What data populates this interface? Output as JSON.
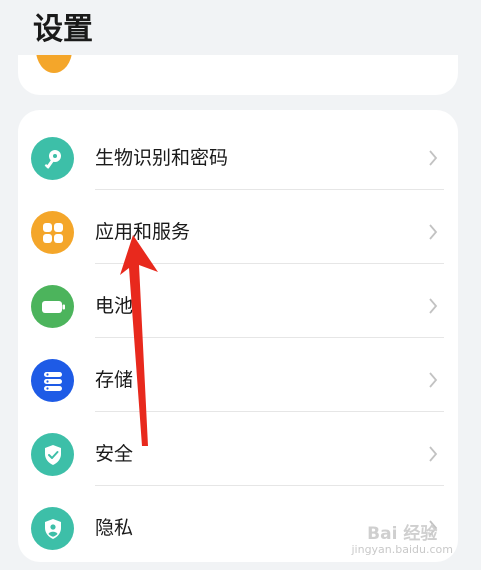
{
  "header": {
    "title": "设置"
  },
  "settings_list": {
    "items": [
      {
        "label": "生物识别和密码",
        "icon": "key-icon",
        "color": "#3dbfa8"
      },
      {
        "label": "应用和服务",
        "icon": "apps-grid-icon",
        "color": "#f4a62a"
      },
      {
        "label": "电池",
        "icon": "battery-icon",
        "color": "#4cb45c"
      },
      {
        "label": "存储",
        "icon": "storage-icon",
        "color": "#1e5be6"
      },
      {
        "label": "安全",
        "icon": "shield-check-icon",
        "color": "#3dbfa8"
      },
      {
        "label": "隐私",
        "icon": "privacy-shield-icon",
        "color": "#3dbfa8"
      }
    ]
  },
  "annotation": {
    "arrow_color": "#e8291d"
  },
  "watermark": {
    "brand": "Bai 经验",
    "url": "jingyan.baidu.com"
  }
}
